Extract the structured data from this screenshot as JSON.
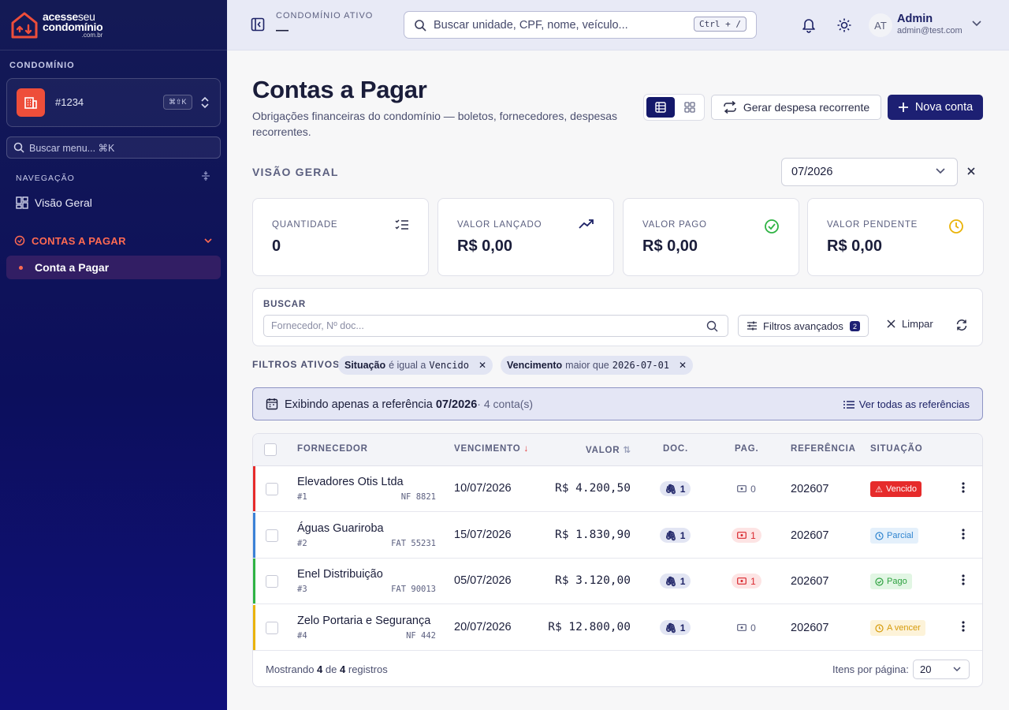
{
  "sidebar": {
    "logo": {
      "line1_bold": "acesse",
      "line1_thin": "seu",
      "line2": "condomínio",
      "line3": ".com.br"
    },
    "condo_label": "CONDOMÍNIO",
    "condo_name": "#1234",
    "condo_shortcut": "⌘⇧K",
    "search_placeholder": "Buscar menu... ⌘K",
    "nav_label": "NAVEGAÇÃO",
    "items": [
      {
        "label": "Visão Geral",
        "icon": "grid-icon"
      },
      {
        "label": "CONTAS A PAGAR",
        "icon": "payments-icon"
      },
      {
        "label": "Conta a Pagar"
      }
    ],
    "colors": {
      "accent": "#ee4e3a",
      "bg_top": "#141a55",
      "bg_bottom": "#10107a"
    }
  },
  "topbar": {
    "condo_ativo_label": "CONDOMÍNIO ATIVO",
    "condo_ativo_value": "—",
    "search_placeholder": "Buscar unidade, CPF, nome, veículo...",
    "search_shortcut": "Ctrl + /",
    "user": {
      "initials": "AT",
      "name": "Admin",
      "email": "admin@test.com"
    }
  },
  "page": {
    "title": "Contas a Pagar",
    "subtitle": "Obrigações financeiras do condomínio — boletos, fornecedores, despesas recorrentes.",
    "btn_recorrente": "Gerar despesa recorrente",
    "btn_nova": "Nova conta",
    "section": "VISÃO GERAL",
    "referencia": "07/2026"
  },
  "stats": [
    {
      "label": "QUANTIDADE",
      "value": "0",
      "icon": "checklist-icon"
    },
    {
      "label": "VALOR LANÇADO",
      "value": "R$ 0,00",
      "icon": "trend-up-icon"
    },
    {
      "label": "VALOR PAGO",
      "value": "R$ 0,00",
      "icon": "check-circle-icon"
    },
    {
      "label": "VALOR PENDENTE",
      "value": "R$ 0,00",
      "icon": "clock-icon"
    }
  ],
  "filters": {
    "search_label": "BUSCAR",
    "search_placeholder": "Fornecedor, Nº doc...",
    "advanced": "Filtros avançados",
    "advanced_count": "2",
    "clear": "Limpar",
    "active_label": "FILTROS ATIVOS:",
    "chips": [
      {
        "field": "Situação",
        "op": "é igual a",
        "value": "Vencido"
      },
      {
        "field": "Vencimento",
        "op": "maior que",
        "value": "2026-07-01"
      }
    ]
  },
  "banner": {
    "prefix": "Exibindo apenas a referência",
    "ref": "07/2026",
    "count": "· 4 conta(s)",
    "link": "Ver todas as referências"
  },
  "table": {
    "headers": [
      "FORNECEDOR",
      "VENCIMENTO",
      "VALOR",
      "DOC.",
      "PAG.",
      "REFERÊNCIA",
      "SITUAÇÃO"
    ],
    "rows": [
      {
        "name": "Elevadores Otis Ltda",
        "id": "#1",
        "doc": "NF 8821",
        "venc": "10/07/2026",
        "valor": "R$ 4.200,50",
        "docs": "1",
        "pags": "0",
        "ref": "202607",
        "status": "Vencido",
        "color": "#e62b2b"
      },
      {
        "name": "Águas Guariroba",
        "id": "#2",
        "doc": "FAT 55231",
        "venc": "15/07/2026",
        "valor": "R$ 1.830,90",
        "docs": "1",
        "pags": "1",
        "ref": "202607",
        "status": "Parcial",
        "color": "#3b82d6"
      },
      {
        "name": "Enel Distribuição",
        "id": "#3",
        "doc": "FAT 90013",
        "venc": "05/07/2026",
        "valor": "R$ 3.120,00",
        "docs": "1",
        "pags": "1",
        "ref": "202607",
        "status": "Pago",
        "color": "#2fb344"
      },
      {
        "name": "Zelo Portaria e Segurança",
        "id": "#4",
        "doc": "NF 442",
        "venc": "20/07/2026",
        "valor": "R$ 12.800,00",
        "docs": "1",
        "pags": "0",
        "ref": "202607",
        "status": "A vencer",
        "color": "#eab308"
      }
    ],
    "footer": {
      "prefix": "Mostrando",
      "shown": "4",
      "of": "de",
      "total": "4",
      "suffix": "registros",
      "per_page_label": "Itens por página:",
      "per_page": "20"
    }
  }
}
